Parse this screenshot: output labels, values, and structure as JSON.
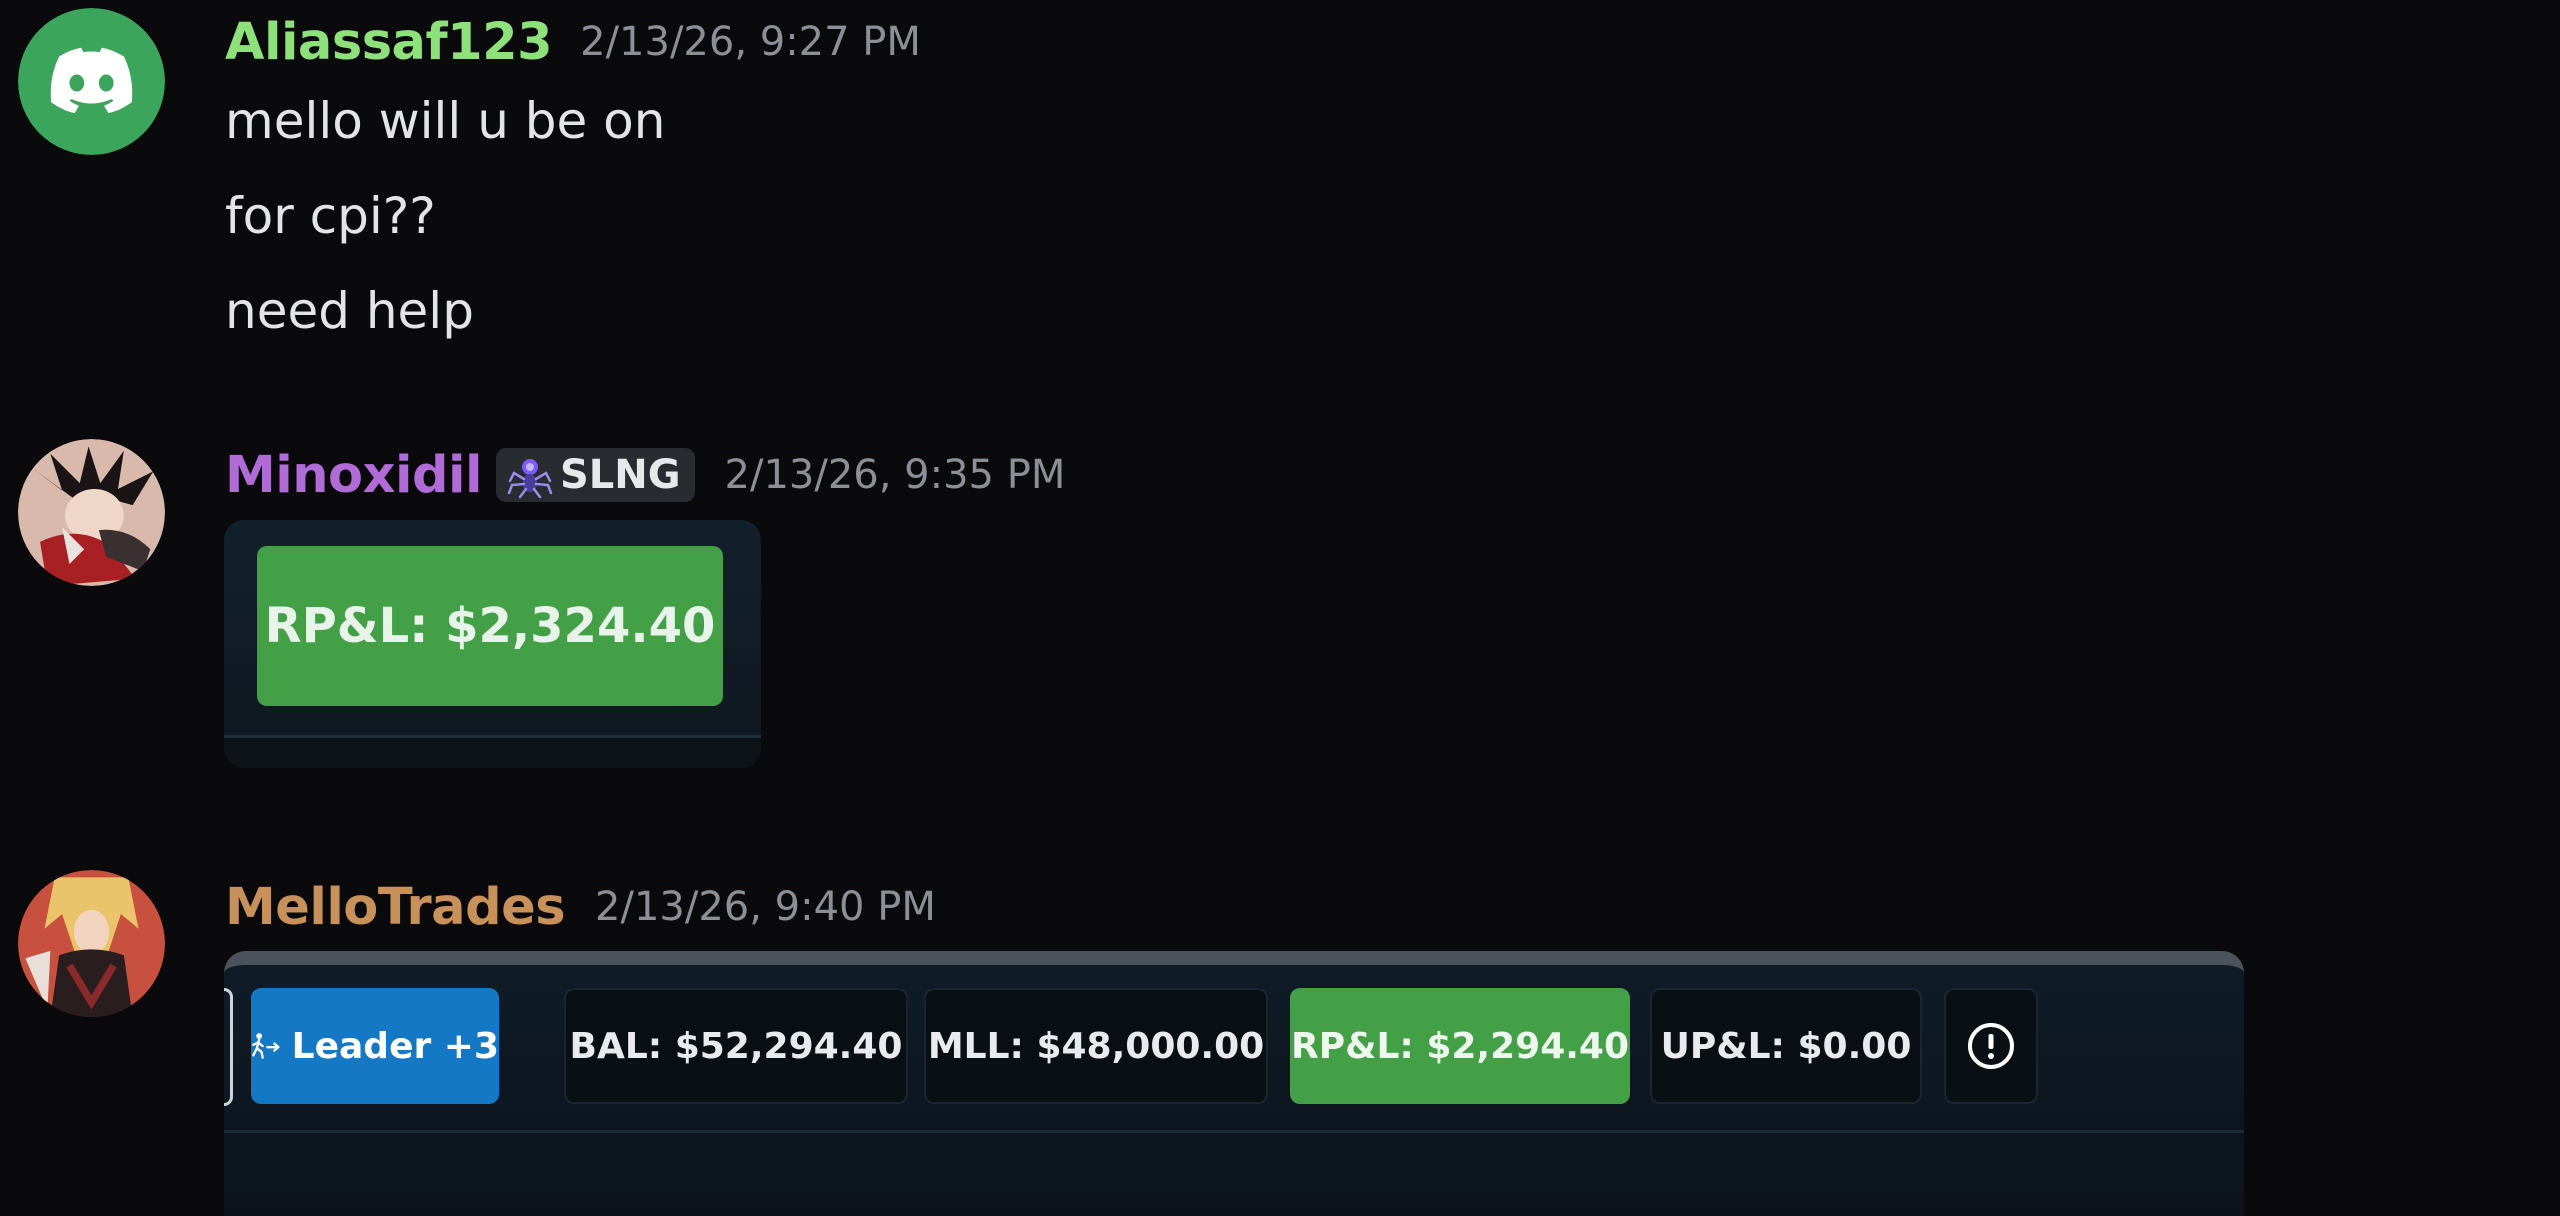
{
  "messages": [
    {
      "username": "Aliassaf123",
      "username_color": "#8ee07a",
      "timestamp": "2/13/26, 9:27 PM",
      "avatar_icon": "discord-icon",
      "avatar_color": "#3ba55c",
      "lines": [
        "mello will u be on",
        "for cpi??",
        "need help"
      ]
    },
    {
      "username": "Minoxidil",
      "username_color": "#b06bd6",
      "tag": "SLNG",
      "tag_icon": "spider-icon",
      "timestamp": "2/13/26, 9:35 PM",
      "attachment": {
        "rpl_label": "RP&L: $2,324.40"
      }
    },
    {
      "username": "MelloTrades",
      "username_color": "#c9915a",
      "timestamp": "2/13/26, 9:40 PM",
      "attachment": {
        "leader_label": "Leader +3",
        "bal_label": "BAL: $52,294.40",
        "mll_label": "MLL: $48,000.00",
        "rpl_label": "RP&L: $2,294.40",
        "upl_label": "UP&L: $0.00",
        "alert_icon": "alert-circle-icon"
      }
    }
  ]
}
